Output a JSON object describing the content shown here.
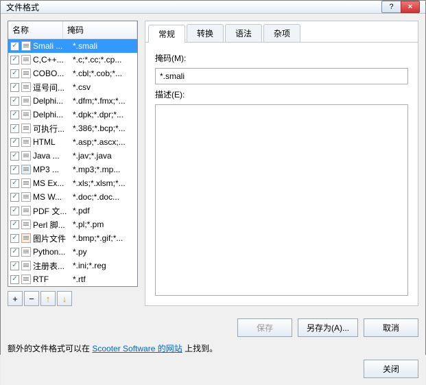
{
  "window": {
    "title": "文件格式"
  },
  "titlebar_buttons": {
    "help": "?",
    "close": "×"
  },
  "list": {
    "header": {
      "name": "名称",
      "mask": "掩码"
    },
    "items": [
      {
        "name": "Smali ...",
        "mask": "*.smali",
        "selected": true,
        "icon": "file"
      },
      {
        "name": "C,C++...",
        "mask": "*.c;*.cc;*.cp...",
        "icon": "file"
      },
      {
        "name": "COBO...",
        "mask": "*.cbl;*.cob;*...",
        "icon": "file"
      },
      {
        "name": "逗号间...",
        "mask": "*.csv",
        "icon": "file"
      },
      {
        "name": "Delphi...",
        "mask": "*.dfm;*.fmx;*...",
        "icon": "file"
      },
      {
        "name": "Delphi...",
        "mask": "*.dpk;*.dpr;*...",
        "icon": "file"
      },
      {
        "name": "可执行...",
        "mask": "*.386;*.bcp;*...",
        "icon": "hex"
      },
      {
        "name": "HTML",
        "mask": "*.asp;*.ascx;...",
        "icon": "file"
      },
      {
        "name": "Java ...",
        "mask": "*.jav;*.java",
        "icon": "file"
      },
      {
        "name": "MP3 ...",
        "mask": "*.mp3;*.mp...",
        "icon": "mp3"
      },
      {
        "name": "MS Ex...",
        "mask": "*.xls;*.xlsm;*...",
        "icon": "file"
      },
      {
        "name": "MS W...",
        "mask": "*.doc;*.doc...",
        "icon": "file"
      },
      {
        "name": "PDF 文...",
        "mask": "*.pdf",
        "icon": "file"
      },
      {
        "name": "Perl 脚...",
        "mask": "*.pl;*.pm",
        "icon": "file"
      },
      {
        "name": "图片文件",
        "mask": "*.bmp;*.gif;*...",
        "icon": "img"
      },
      {
        "name": "Python...",
        "mask": "*.py",
        "icon": "file"
      },
      {
        "name": "注册表...",
        "mask": "*.ini;*.reg",
        "icon": "file"
      },
      {
        "name": "RTF",
        "mask": "*.rtf",
        "icon": "file"
      }
    ]
  },
  "toolbar": {
    "add": "+",
    "remove": "−",
    "up": "↑",
    "down": "↓"
  },
  "tabs": {
    "general": "常规",
    "convert": "转换",
    "syntax": "语法",
    "misc": "杂项"
  },
  "form": {
    "mask_label": "掩码(M):",
    "mask_value": "*.smali",
    "desc_label": "描述(E):",
    "desc_value": ""
  },
  "buttons": {
    "save": "保存",
    "saveas": "另存为(A)...",
    "cancel": "取消",
    "close": "关闭"
  },
  "note": {
    "prefix": "额外的文件格式可以在 ",
    "link": "Scooter Software 的网站",
    "suffix": " 上找到。"
  }
}
